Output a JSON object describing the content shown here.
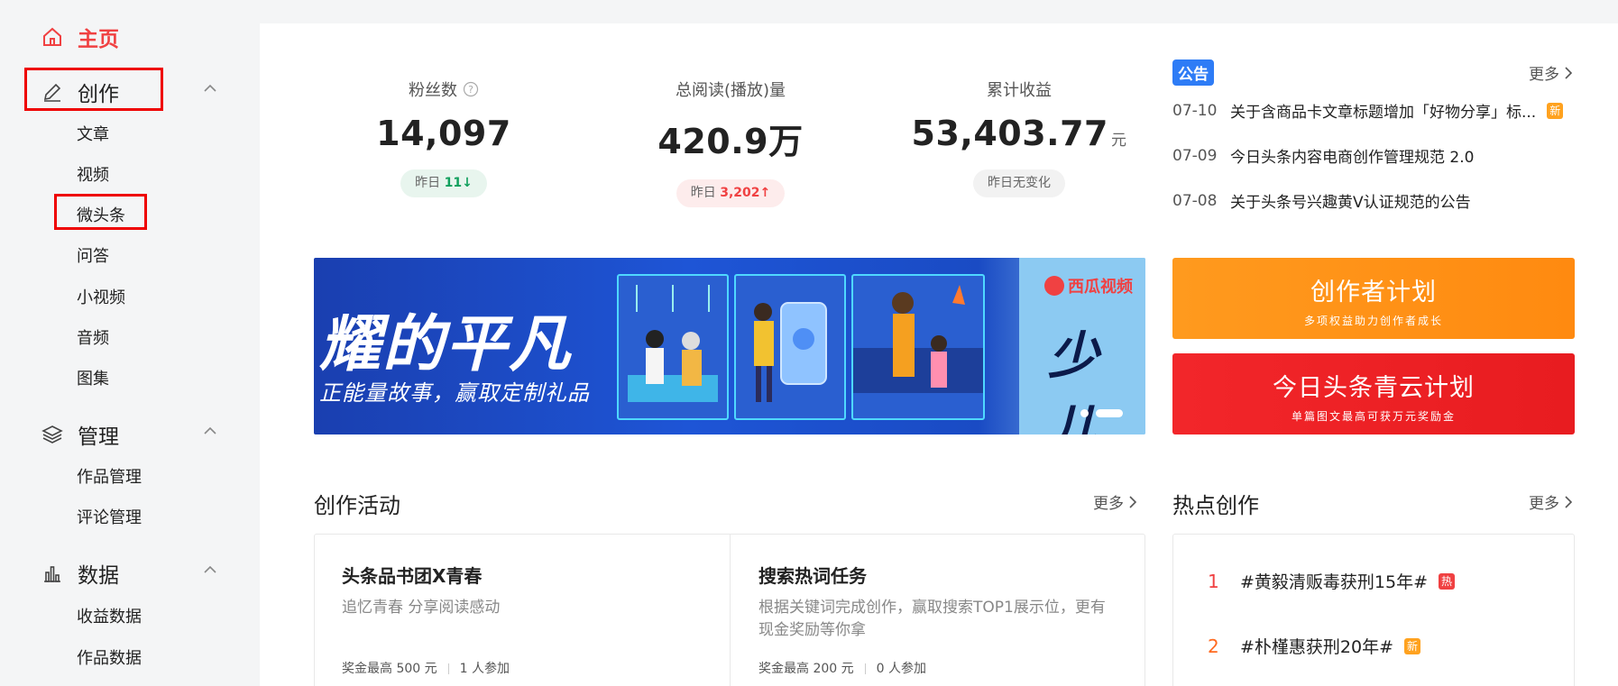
{
  "sidebar": {
    "home": "主页",
    "groups": [
      {
        "label": "创作",
        "items": [
          "文章",
          "视频",
          "微头条",
          "问答",
          "小视频",
          "音频",
          "图集"
        ]
      },
      {
        "label": "管理",
        "items": [
          "作品管理",
          "评论管理"
        ]
      },
      {
        "label": "数据",
        "items": [
          "收益数据",
          "作品数据"
        ]
      }
    ]
  },
  "stats": [
    {
      "label": "粉丝数",
      "value": "14,097",
      "unit": "",
      "pill_prefix": "昨日",
      "pill_value": "11",
      "pill_arrow": "↓"
    },
    {
      "label": "总阅读(播放)量",
      "value": "420.9万",
      "unit": "",
      "pill_prefix": "昨日",
      "pill_value": "3,202",
      "pill_arrow": "↑"
    },
    {
      "label": "累计收益",
      "value": "53,403.77",
      "unit": "元",
      "pill_text": "昨日无变化"
    }
  ],
  "notices": {
    "badge": "公告",
    "more": "更多",
    "items": [
      {
        "date": "07-10",
        "text": "关于含商品卡文章标题增加「好物分享」标...",
        "tag": "新"
      },
      {
        "date": "07-09",
        "text": "今日头条内容电商创作管理规范 2.0",
        "tag": ""
      },
      {
        "date": "07-08",
        "text": "关于头条号兴趣黄V认证规范的公告",
        "tag": ""
      }
    ]
  },
  "banner": {
    "title": "耀的平凡",
    "subtitle": "正能量故事，赢取定制礼品",
    "brand": "西瓜视频",
    "brand_big": "少儿"
  },
  "side_banners": [
    {
      "title": "创作者计划",
      "subtitle": "多项权益助力创作者成长"
    },
    {
      "title": "今日头条青云计划",
      "subtitle": "单篇图文最高可获万元奖励金"
    }
  ],
  "activities": {
    "title": "创作活动",
    "more": "更多",
    "cards": [
      {
        "title": "头条品书团X青春",
        "desc": "追忆青春 分享阅读感动",
        "reward": "奖金最高 500 元",
        "people": "1 人参加"
      },
      {
        "title": "搜索热词任务",
        "desc": "根据关键词完成创作，赢取搜索TOP1展示位，更有现金奖励等你拿",
        "reward": "奖金最高 200 元",
        "people": "0 人参加"
      }
    ]
  },
  "hot": {
    "title": "热点创作",
    "more": "更多",
    "items": [
      {
        "rank": "1",
        "text": "#黄毅清贩毒获刑15年#",
        "tag": "热"
      },
      {
        "rank": "2",
        "text": "#朴槿惠获刑20年#",
        "tag": "新"
      }
    ]
  },
  "colors": {
    "brand_red": "#f04142",
    "accent_blue": "#2e7cf6",
    "success_green": "#11a05d"
  }
}
